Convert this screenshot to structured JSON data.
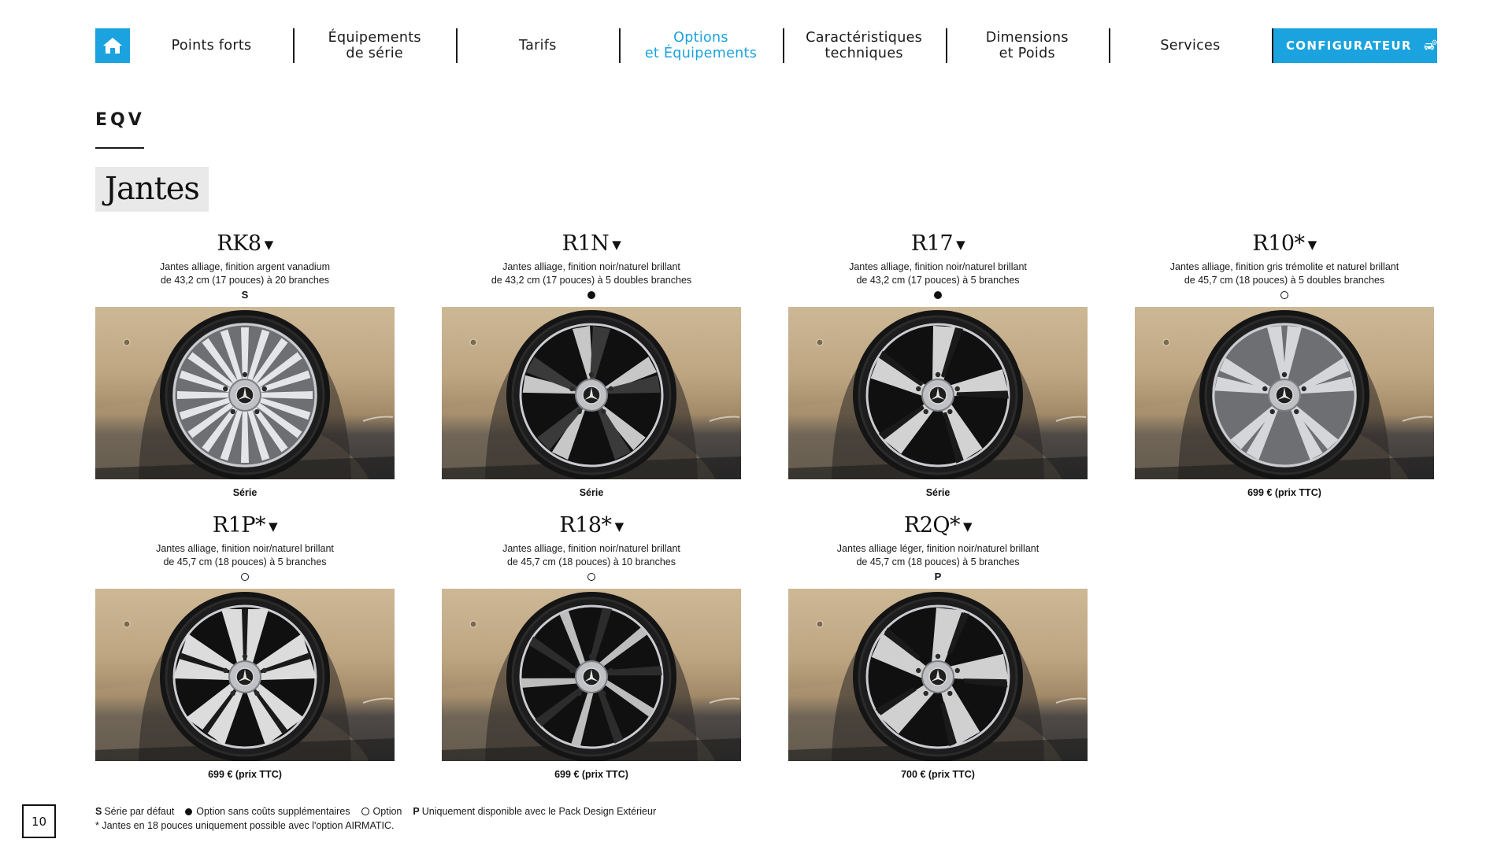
{
  "nav": {
    "items": [
      {
        "label": "Points forts",
        "active": false
      },
      {
        "label": "Équipements\nde série",
        "active": false
      },
      {
        "label": "Tarifs",
        "active": false
      },
      {
        "label": "Options\net Équipements",
        "active": true
      },
      {
        "label": "Caractéristiques\ntechniques",
        "active": false
      },
      {
        "label": "Dimensions\net Poids",
        "active": false
      },
      {
        "label": "Services",
        "active": false
      }
    ],
    "configurator_label": "CONFIGURATEUR",
    "accent_color": "#1aa3de"
  },
  "header": {
    "model": "EQV",
    "section_title": "Jantes"
  },
  "wheels": [
    {
      "code": "RK8",
      "desc_line1": "Jantes alliage, finition argent vanadium",
      "desc_line2": "de 43,2 cm (17 pouces) à 20 branches",
      "symbol": "S",
      "symbol_type": "letter",
      "price": "Série",
      "style": "multispoke"
    },
    {
      "code": "R1N",
      "desc_line1": "Jantes alliage, finition noir/naturel brillant",
      "desc_line2": "de 43,2 cm (17 pouces) à 5 doubles branches",
      "symbol": "",
      "symbol_type": "filled",
      "price": "Série",
      "style": "twin-black"
    },
    {
      "code": "R17",
      "desc_line1": "Jantes alliage, finition noir/naturel brillant",
      "desc_line2": "de 43,2 cm (17 pouces) à 5 branches",
      "symbol": "",
      "symbol_type": "filled",
      "price": "Série",
      "style": "five-twist"
    },
    {
      "code": "R10*",
      "desc_line1": "Jantes alliage, finition gris trémolite et naturel brillant",
      "desc_line2": "de 45,7 cm (18 pouces) à 5 doubles branches",
      "symbol": "",
      "symbol_type": "empty",
      "price": "699 € (prix TTC)",
      "style": "twin-silver"
    },
    {
      "code": "R1P*",
      "desc_line1": "Jantes alliage, finition noir/naturel brillant",
      "desc_line2": "de 45,7 cm (18 pouces) à 5 branches",
      "symbol": "",
      "symbol_type": "empty",
      "price": "699 € (prix TTC)",
      "style": "five-bold"
    },
    {
      "code": "R18*",
      "desc_line1": "Jantes alliage, finition noir/naturel brillant",
      "desc_line2": "de 45,7 cm (18 pouces) à 10 branches",
      "symbol": "",
      "symbol_type": "empty",
      "price": "699 € (prix TTC)",
      "style": "ten-turbine"
    },
    {
      "code": "R2Q*",
      "desc_line1": "Jantes alliage léger, finition noir/naturel brillant",
      "desc_line2": "de 45,7 cm (18 pouces) à 5 branches",
      "symbol": "P",
      "symbol_type": "letter",
      "price": "700 € (prix TTC)",
      "style": "five-aero"
    }
  ],
  "legend": {
    "s_key": "S",
    "s_text": "Série par défaut",
    "filled_text": "Option sans coûts supplémentaires",
    "empty_text": "Option",
    "p_key": "P",
    "p_text": "Uniquement disponible avec le Pack Design Extérieur",
    "note": "*  Jantes en 18 pouces uniquement possible avec l'option AIRMATIC."
  },
  "page_number": "10"
}
